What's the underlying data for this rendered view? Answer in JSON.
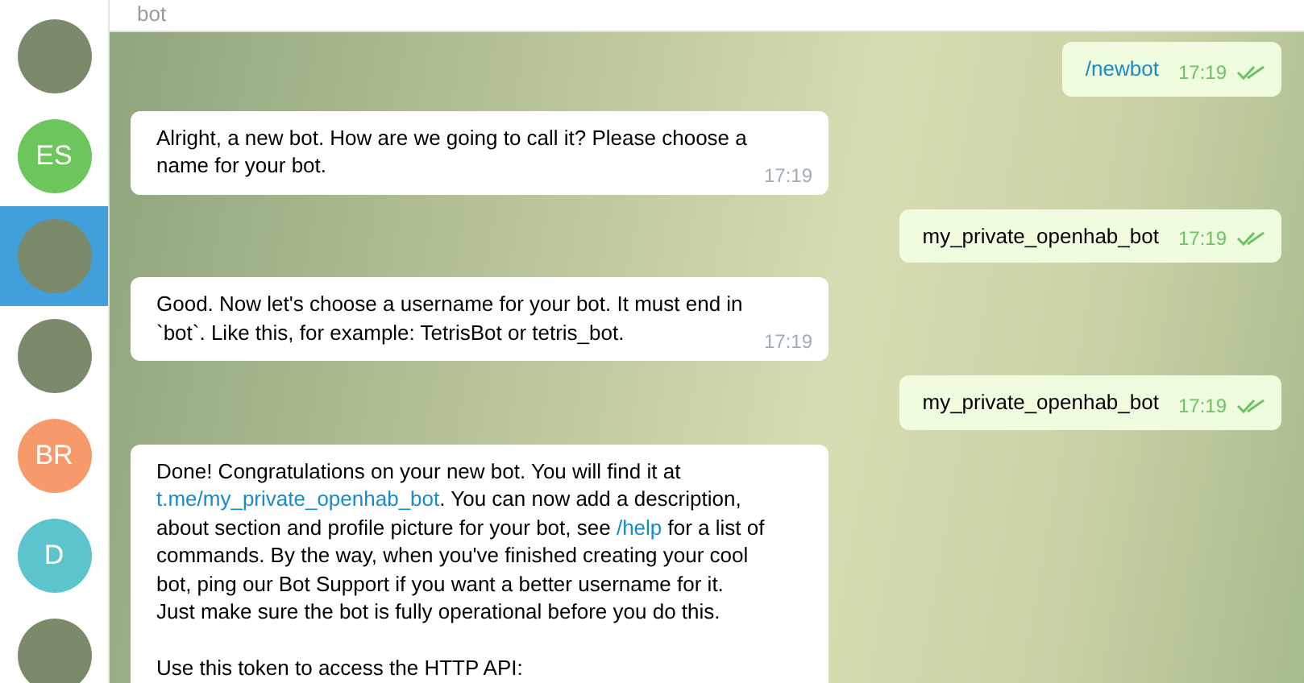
{
  "header": {
    "subtitle": "bot"
  },
  "sidebar": {
    "items": [
      {
        "kind": "photo",
        "selected": false
      },
      {
        "kind": "initials",
        "initials": "ES",
        "color": "#6cc65b",
        "selected": false
      },
      {
        "kind": "photo",
        "selected": true
      },
      {
        "kind": "photo",
        "selected": false
      },
      {
        "kind": "initials",
        "initials": "BR",
        "color": "#f79a6b",
        "selected": false
      },
      {
        "kind": "initials",
        "initials": "D",
        "color": "#5bc4cc",
        "selected": false
      },
      {
        "kind": "photo",
        "selected": false
      }
    ]
  },
  "messages": [
    {
      "kind": "outgoing",
      "paragraphs": [
        [
          {
            "kind": "link",
            "text": "/newbot"
          }
        ]
      ],
      "time": "17:19",
      "read": true
    },
    {
      "kind": "incoming",
      "paragraphs": [
        [
          {
            "kind": "text",
            "text": "Alright, a new bot. How are we going to call it? Please choose a name for your bot."
          }
        ]
      ],
      "time": "17:19"
    },
    {
      "kind": "outgoing",
      "paragraphs": [
        [
          {
            "kind": "text",
            "text": "my_private_openhab_bot"
          }
        ]
      ],
      "time": "17:19",
      "read": true
    },
    {
      "kind": "incoming",
      "paragraphs": [
        [
          {
            "kind": "text",
            "text": "Good. Now let's choose a username for your bot. It must end in `bot`. Like this, for example: TetrisBot or tetris_bot."
          }
        ]
      ],
      "time": "17:19"
    },
    {
      "kind": "outgoing",
      "paragraphs": [
        [
          {
            "kind": "text",
            "text": "my_private_openhab_bot"
          }
        ]
      ],
      "time": "17:19",
      "read": true
    },
    {
      "kind": "incoming",
      "paragraphs": [
        [
          {
            "kind": "text",
            "text": "Done! Congratulations on your new bot. You will find it at "
          },
          {
            "kind": "link",
            "text": "t.me/my_private_openhab_bot"
          },
          {
            "kind": "text",
            "text": ". You can now add a description, about section and profile picture for your bot, see "
          },
          {
            "kind": "link",
            "text": "/help"
          },
          {
            "kind": "text",
            "text": " for a list of commands. By the way, when you've finished creating your cool bot, ping our Bot Support if you want a better username for it. Just make sure the bot is fully operational before you do this."
          }
        ],
        [
          {
            "kind": "text",
            "text": "Use this token to access the HTTP API:"
          }
        ]
      ]
    }
  ]
}
